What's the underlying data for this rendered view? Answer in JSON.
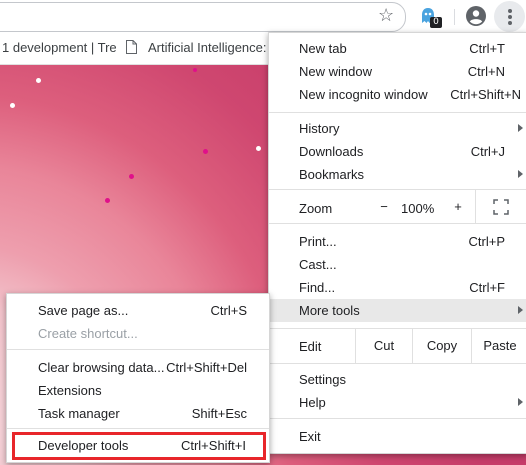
{
  "toolbar": {
    "star_icon": "star-icon",
    "extension_badge": "0",
    "profile_icon": "account-circle-icon",
    "menu_icon": "kebab-menu-icon"
  },
  "bookmarks": {
    "item1": "1 development | Tre",
    "item2": "Artificial Intelligence:"
  },
  "menu": {
    "new_tab": {
      "label": "New tab",
      "shortcut": "Ctrl+T"
    },
    "new_window": {
      "label": "New window",
      "shortcut": "Ctrl+N"
    },
    "new_incognito": {
      "label": "New incognito window",
      "shortcut": "Ctrl+Shift+N"
    },
    "history": {
      "label": "History"
    },
    "downloads": {
      "label": "Downloads",
      "shortcut": "Ctrl+J"
    },
    "bookmarks": {
      "label": "Bookmarks"
    },
    "zoom": {
      "label": "Zoom",
      "minus": "−",
      "value": "100%",
      "plus": "+"
    },
    "print": {
      "label": "Print...",
      "shortcut": "Ctrl+P"
    },
    "cast": {
      "label": "Cast..."
    },
    "find": {
      "label": "Find...",
      "shortcut": "Ctrl+F"
    },
    "more_tools": {
      "label": "More tools"
    },
    "edit": {
      "label": "Edit",
      "cut": "Cut",
      "copy": "Copy",
      "paste": "Paste"
    },
    "settings": {
      "label": "Settings"
    },
    "help": {
      "label": "Help"
    },
    "exit": {
      "label": "Exit"
    }
  },
  "submenu": {
    "save_page": {
      "label": "Save page as...",
      "shortcut": "Ctrl+S"
    },
    "create_shortcut": {
      "label": "Create shortcut..."
    },
    "clear_browsing": {
      "label": "Clear browsing data...",
      "shortcut": "Ctrl+Shift+Del"
    },
    "extensions": {
      "label": "Extensions"
    },
    "task_manager": {
      "label": "Task manager",
      "shortcut": "Shift+Esc"
    },
    "developer_tools": {
      "label": "Developer tools",
      "shortcut": "Ctrl+Shift+I"
    }
  },
  "colors": {
    "highlight_outline": "#e8262a",
    "page_background": "#cf4770"
  }
}
